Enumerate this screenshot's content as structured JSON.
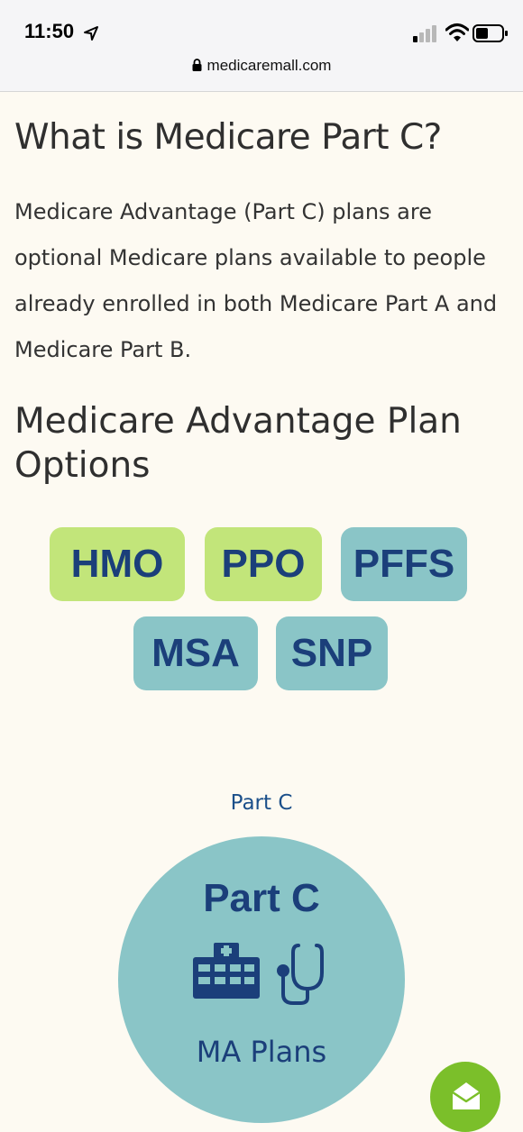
{
  "status_bar": {
    "time": "11:50",
    "url": "medicaremall.com",
    "icons": [
      "location-arrow-icon",
      "signal-icon",
      "wifi-icon",
      "battery-icon",
      "lock-icon"
    ]
  },
  "article": {
    "title": "What is Medicare Part C?",
    "intro": "Medicare Advantage (Part C) plans are optional Medicare plans available to people already enrolled in both Medicare Part A and Medicare Part B.",
    "options_heading": "Medicare Advantage Plan Options"
  },
  "plan_options": [
    {
      "label": "HMO",
      "color": "#c2e57a"
    },
    {
      "label": "PPO",
      "color": "#c2e57a"
    },
    {
      "label": "PFFS",
      "color": "#8ac5c7"
    },
    {
      "label": "MSA",
      "color": "#8ac5c7"
    },
    {
      "label": "SNP",
      "color": "#8ac5c7"
    }
  ],
  "part_c": {
    "label": "Part C",
    "circle_title": "Part C",
    "circle_subtitle": "MA Plans",
    "icons": [
      "hospital-icon",
      "stethoscope-icon"
    ]
  },
  "fab": {
    "icon": "mail-icon",
    "color": "#7bbf2a"
  },
  "colors": {
    "background": "#fdfaf2",
    "navy": "#1b3f7a",
    "green": "#c2e57a",
    "teal": "#8ac5c7"
  }
}
